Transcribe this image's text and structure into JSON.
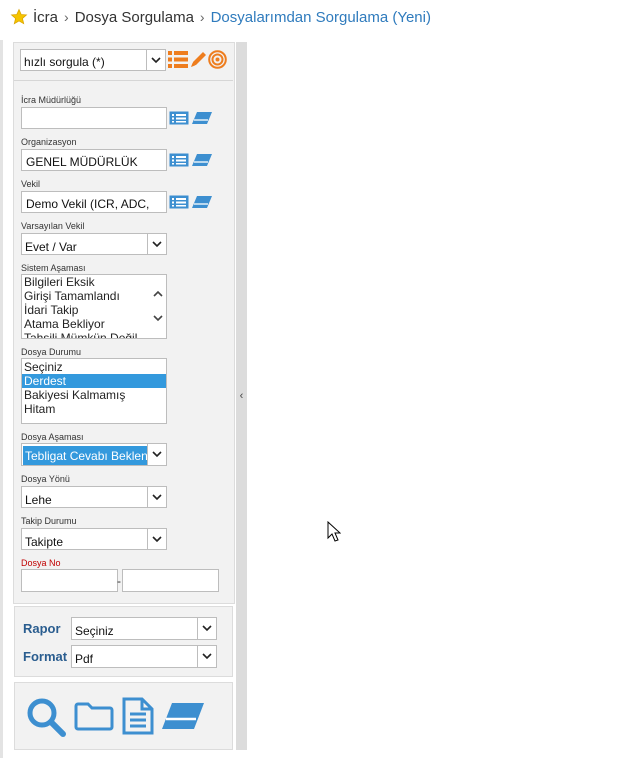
{
  "breadcrumb": {
    "root": "İcra",
    "middle": "Dosya Sorgulama",
    "current": "Dosyalarımdan Sorgulama (Yeni)"
  },
  "quick_query": {
    "value": "hızlı sorgula (*)"
  },
  "fields": {
    "icra_mudurlugu": {
      "label": "İcra Müdürlüğü",
      "value": ""
    },
    "organizasyon": {
      "label": "Organizasyon",
      "value": "GENEL MÜDÜRLÜK"
    },
    "vekil": {
      "label": "Vekil",
      "value": "Demo Vekil (ICR, ADC,"
    },
    "varsayilan_vekil": {
      "label": "Varsayılan Vekil",
      "value": "Evet / Var"
    },
    "sistem_asamasi": {
      "label": "Sistem Aşaması",
      "items": [
        "Bilgileri Eksik",
        "Girişi Tamamlandı",
        "İdari Takip",
        "Atama Bekliyor",
        "Tahsili Mümkün Değil"
      ]
    },
    "dosya_durumu": {
      "label": "Dosya Durumu",
      "items": [
        "Seçiniz",
        "Derdest",
        "Bakiyesi Kalmamış",
        "Hitam"
      ],
      "selected": "Derdest"
    },
    "dosya_asamasi": {
      "label": "Dosya Aşaması",
      "value": "Tebligat Cevabı Bekleniyor"
    },
    "dosya_yonu": {
      "label": "Dosya Yönü",
      "value": "Lehe"
    },
    "takip_durumu": {
      "label": "Takip Durumu",
      "value": "Takipte"
    },
    "dosya_no": {
      "label": "Dosya No",
      "from": "",
      "separator": "-",
      "to": ""
    }
  },
  "report": {
    "rapor_label": "Rapor",
    "rapor_value": "Seçiniz",
    "format_label": "Format",
    "format_value": "Pdf"
  },
  "colors": {
    "accent_orange": "#ee7d1e",
    "icon_blue": "#3d8fd0",
    "selection_blue": "#3399dd",
    "link_blue": "#2f7bbd"
  },
  "icons": [
    "star-icon",
    "list-icon",
    "pencil-icon",
    "target-icon",
    "list-picker-icon",
    "eraser-icon",
    "search-icon",
    "folder-icon",
    "document-icon"
  ]
}
